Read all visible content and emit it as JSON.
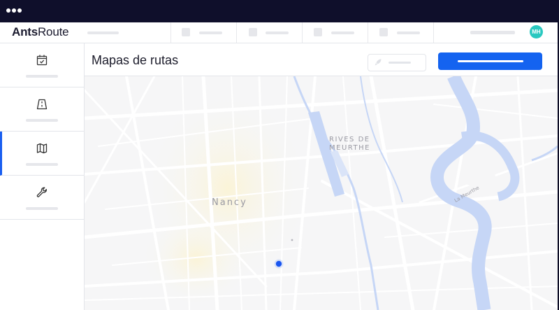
{
  "window": {
    "controls": [
      "dot",
      "dot",
      "dot"
    ]
  },
  "app": {
    "brand_strong": "Ants",
    "brand_light": "Route",
    "user_initials": "MH",
    "avatar_color": "#29c8c0"
  },
  "sidebar": {
    "items": [
      {
        "icon": "calendar-check-icon",
        "active": false
      },
      {
        "icon": "road-icon",
        "active": false
      },
      {
        "icon": "map-icon",
        "active": true
      },
      {
        "icon": "wrench-icon",
        "active": false
      }
    ]
  },
  "page": {
    "title": "Mapas de rutas",
    "accent_color": "#1463f0"
  },
  "map": {
    "labels": {
      "city": "Nancy",
      "district_line1": "RIVES DE",
      "district_line2": "MEURTHE",
      "river": "La Meurthe"
    },
    "marker_color": "#1a56f0",
    "water_color": "#c6d6f6"
  }
}
